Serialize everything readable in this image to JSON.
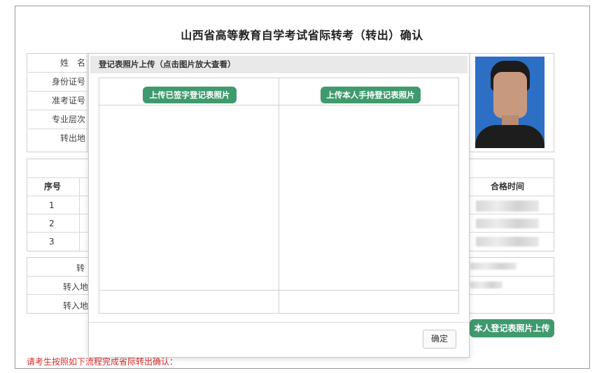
{
  "page": {
    "title": "山西省高等教育自学考试省际转考（转出）确认"
  },
  "info": {
    "labels": [
      "姓　名",
      "身份证号",
      "准考证号",
      "专业层次",
      "转出地"
    ]
  },
  "scores": {
    "headers": {
      "seq": "序号",
      "pass_time": "合格时间"
    },
    "rows": [
      "1",
      "2",
      "3"
    ]
  },
  "transfer": {
    "labels": [
      "转",
      "转入地",
      "转入地"
    ]
  },
  "actions": {
    "upload_own": "本人登记表照片上传"
  },
  "notice": "请考生按照如下流程完成省际转出确认：",
  "modal": {
    "title": "登记表照片上传（点击图片放大查看）",
    "btn_signed": "上传已签字登记表照片",
    "btn_holding": "上传本人手持登记表照片",
    "ok": "确定"
  },
  "colors": {
    "accent": "#3f9a6e",
    "notice": "#d92c2c",
    "photo_bg": "#2d6fc4"
  }
}
